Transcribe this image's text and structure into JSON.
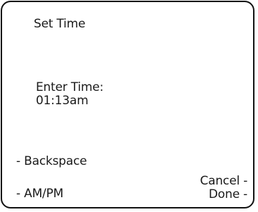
{
  "screen": {
    "title": "Set Time",
    "prompt_label": "Enter Time:",
    "time_value": "01:13am"
  },
  "softkeys": {
    "left": [
      {
        "label": "- Backspace"
      },
      {
        "label": "- AM/PM"
      }
    ],
    "right": [
      {
        "label": "Cancel -"
      },
      {
        "label": "Done -"
      }
    ]
  }
}
